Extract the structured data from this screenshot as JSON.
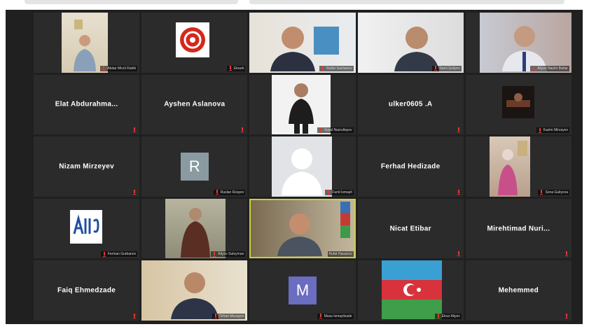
{
  "tiles": [
    {
      "name": "Abdar Mirzli Rahib",
      "type": "video"
    },
    {
      "name": "Elnarb",
      "type": "logo"
    },
    {
      "name": "Ruhin Gurbanov",
      "type": "video"
    },
    {
      "name": "Sami Quliyev",
      "type": "video"
    },
    {
      "name": "Aliyev Nazim Bahar",
      "type": "video"
    },
    {
      "name": "Elat Abdurahma...",
      "type": "text"
    },
    {
      "name": "Ayshen Aslanova",
      "type": "text"
    },
    {
      "name": "Vusal Nasrullayev",
      "type": "video"
    },
    {
      "name": "ulker0605 .A",
      "type": "text"
    },
    {
      "name": "Kazim Mirzayev",
      "type": "video"
    },
    {
      "name": "Nizam Mirzeyev",
      "type": "text"
    },
    {
      "name": "Ruslan Rzayev",
      "type": "avatar",
      "letter": "R",
      "color": "#8a9aa1"
    },
    {
      "name": "Farid Ismayil",
      "type": "silhouette"
    },
    {
      "name": "Ferhad Hedizade",
      "type": "text"
    },
    {
      "name": "Sona Guliyeva",
      "type": "video"
    },
    {
      "name": "Ferman Gurbanov",
      "type": "logo2"
    },
    {
      "name": "Aliyev Suleyman",
      "type": "video"
    },
    {
      "name": "Rufat Hasanov",
      "type": "video",
      "speaker": true
    },
    {
      "name": "Nicat Etibar",
      "type": "text"
    },
    {
      "name": "Mirehtimad Nuri...",
      "type": "text"
    },
    {
      "name": "Faiq Ehmedzade",
      "type": "text"
    },
    {
      "name": "Orhan Musayev",
      "type": "video"
    },
    {
      "name": "Musa Ismayilzade",
      "type": "avatar",
      "letter": "M",
      "color": "#6b6dc0"
    },
    {
      "name": "Elnur Aliyev",
      "type": "flag"
    },
    {
      "name": "Mehemmed",
      "type": "text"
    }
  ],
  "colors": {
    "background": "#202020",
    "tile": "#2b2b2b",
    "speaker_outline": "#c8d23a",
    "mute": "#e33c2e"
  },
  "icons": {
    "mute": "mic-off-icon"
  }
}
